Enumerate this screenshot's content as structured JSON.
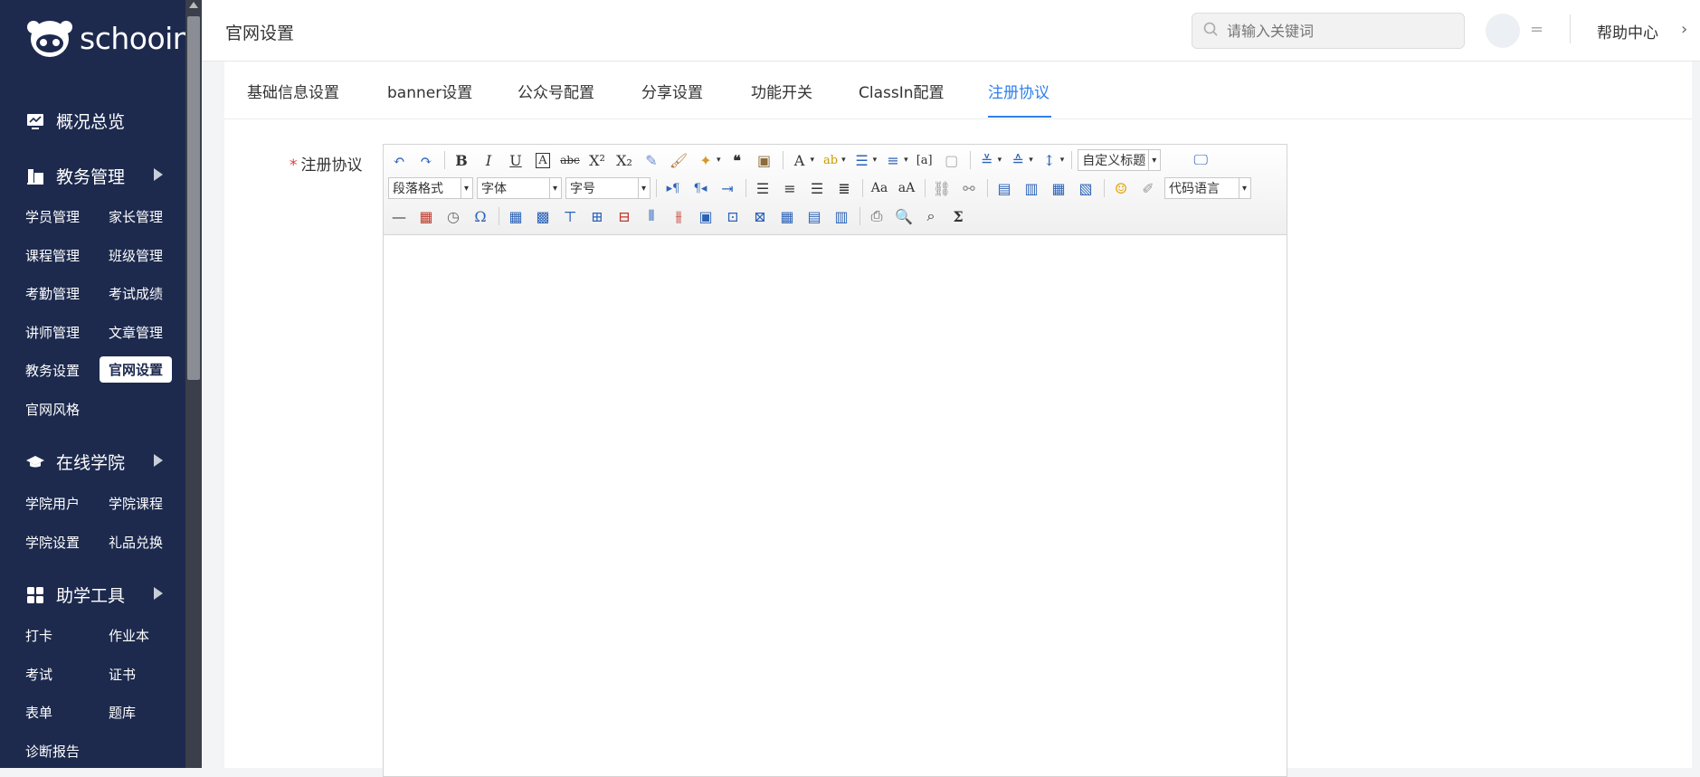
{
  "brand": {
    "name": "schooin"
  },
  "sidebar": {
    "sections": [
      {
        "title": "概况总览"
      },
      {
        "title": "教务管理",
        "items": [
          "学员管理",
          "家长管理",
          "课程管理",
          "班级管理",
          "考勤管理",
          "考试成绩",
          "讲师管理",
          "文章管理",
          "教务设置",
          "官网设置",
          "官网风格"
        ]
      },
      {
        "title": "在线学院",
        "items": [
          "学院用户",
          "学院课程",
          "学院设置",
          "礼品兑换"
        ]
      },
      {
        "title": "助学工具",
        "items": [
          "打卡",
          "作业本",
          "考试",
          "证书",
          "表单",
          "题库",
          "诊断报告"
        ]
      }
    ]
  },
  "header": {
    "title": "官网设置",
    "search_placeholder": "请输入关键词",
    "menu_glyph": "=",
    "help": "帮助中心"
  },
  "tabs": [
    "基础信息设置",
    "banner设置",
    "公众号配置",
    "分享设置",
    "功能开关",
    "ClassIn配置",
    "注册协议"
  ],
  "active_tab": "注册协议",
  "form": {
    "required_mark": "*",
    "label": "注册协议"
  },
  "editor": {
    "custom_heading": "自定义标题",
    "paragraph_format": "段落格式",
    "font_family": "字体",
    "font_size": "字号",
    "code_language": "代码语言"
  },
  "colors": {
    "sidebar": "#1d2a4e",
    "accent": "#2f80ed",
    "required": "#e53935"
  }
}
